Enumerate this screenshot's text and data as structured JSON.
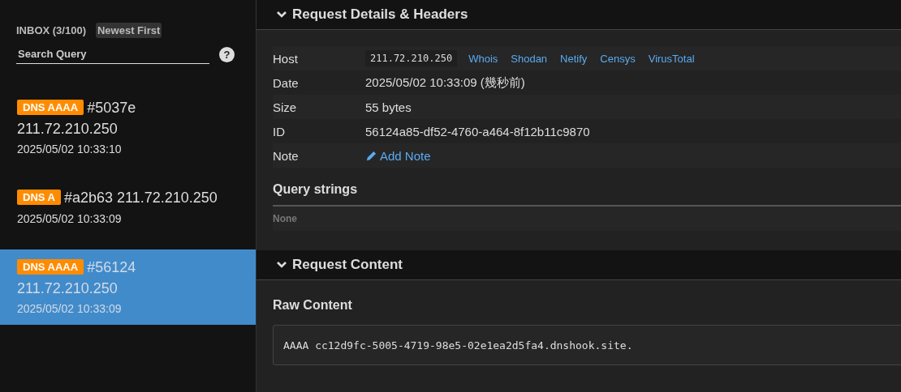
{
  "sidebar": {
    "inbox_label": "INBOX (3/100)",
    "sort_button": "Newest First",
    "search": {
      "placeholder": "Search Query"
    },
    "help": "?",
    "items": [
      {
        "tag": "DNS AAAA",
        "id": "#5037e",
        "ip": "211.72.210.250",
        "time": "2025/05/02 10:33:10",
        "selected": false
      },
      {
        "tag": "DNS A",
        "id": "#a2b63",
        "ip": "211.72.210.250",
        "time": "2025/05/02 10:33:09",
        "selected": false
      },
      {
        "tag": "DNS AAAA",
        "id": "#56124",
        "ip": "211.72.210.250",
        "time": "2025/05/02 10:33:09",
        "selected": true
      }
    ]
  },
  "details": {
    "title": "Request Details & Headers",
    "expanded": true,
    "rows": [
      {
        "kind": "host",
        "label": "Host",
        "value": "211.72.210.250",
        "links": [
          "Whois",
          "Shodan",
          "Netify",
          "Censys",
          "VirusTotal"
        ]
      },
      {
        "kind": "text",
        "label": "Date",
        "value": "2025/05/02 10:33:09 (幾秒前)"
      },
      {
        "kind": "text",
        "label": "Size",
        "value": "55 bytes"
      },
      {
        "kind": "text",
        "label": "ID",
        "value": "56124a85-df52-4760-a464-8f12b11c9870"
      },
      {
        "kind": "link",
        "label": "Note",
        "value": "Add Note"
      }
    ],
    "query_title": "Query strings",
    "query_empty": "None"
  },
  "content": {
    "title": "Request Content",
    "expanded": true,
    "raw_title": "Raw Content",
    "raw": "AAAA cc12d9fc-5005-4719-98e5-02e1ea2d5fa4.dnshook.site."
  }
}
